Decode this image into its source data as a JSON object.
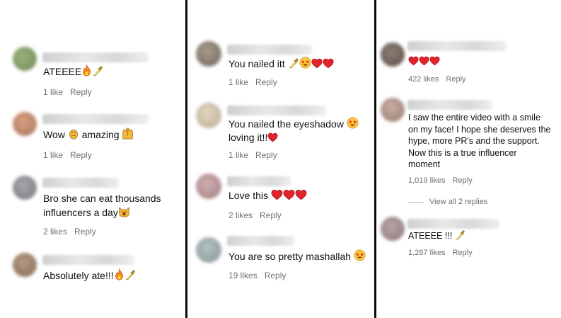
{
  "panel1": {
    "comments": [
      {
        "text": "ATEEEE",
        "emoji": [
          "fire-emoji",
          "nail-polish-emoji"
        ],
        "likes": "1 like",
        "reply": "Reply"
      },
      {
        "text": "Wow",
        "text2": "amazing",
        "emoji": [
          "clapping-hands-emoji",
          "raising-hands-emoji"
        ],
        "likes": "1 like",
        "reply": "Reply"
      },
      {
        "text": "Bro she can eat thousands",
        "text_line2": "influencers a day",
        "emoji": [
          "weary-cat-emoji"
        ],
        "likes": "2 likes",
        "reply": "Reply"
      },
      {
        "text": "Absolutely ate!!!",
        "emoji": [
          "fire-emoji",
          "nail-polish-emoji"
        ]
      }
    ]
  },
  "panel2": {
    "comments": [
      {
        "text": "You nailed itt",
        "emoji": [
          "nail-polish-emoji",
          "star-struck-emoji",
          "red-heart-emoji",
          "red-heart-emoji"
        ],
        "likes": "1 like",
        "reply": "Reply"
      },
      {
        "text": "You nailed the eyeshadow",
        "text_line2": "loving it!!",
        "emoji": [
          "star-struck-emoji",
          "red-heart-emoji"
        ],
        "likes": "1 like",
        "reply": "Reply"
      },
      {
        "text": "Love this",
        "emoji": [
          "red-heart-emoji",
          "red-heart-emoji",
          "red-heart-emoji"
        ],
        "likes": "2 likes",
        "reply": "Reply"
      },
      {
        "text": "You are so pretty mashallah",
        "emoji": [
          "star-struck-emoji"
        ],
        "likes": "19 likes",
        "reply": "Reply"
      }
    ]
  },
  "panel3": {
    "comments": [
      {
        "emoji": [
          "red-heart-emoji",
          "red-heart-emoji",
          "red-heart-emoji"
        ],
        "likes": "422 likes",
        "reply": "Reply"
      },
      {
        "lines": [
          "I saw the entire video with a smile",
          "on my face! I hope she deserves the",
          "hype, more PR's and the support.",
          "Now this is a true influencer",
          "moment"
        ],
        "likes": "1,019 likes",
        "reply": "Reply"
      },
      {
        "view_replies": "View all 2 replies"
      },
      {
        "text": "ATEEEE !!!",
        "emoji": [
          "nail-polish-emoji"
        ],
        "likes": "1,287 likes",
        "reply": "Reply"
      }
    ]
  },
  "colors": {
    "divider": "#0a0a0a",
    "meta_text": "#707070",
    "heart": "#e0242b",
    "fire": "#f08a1c"
  }
}
